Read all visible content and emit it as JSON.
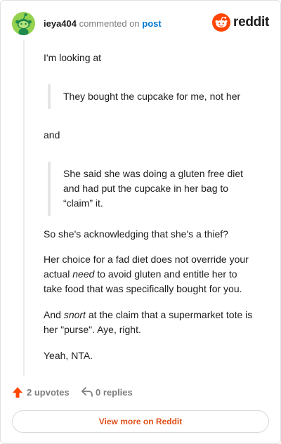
{
  "header": {
    "username": "ieya404",
    "action": "commented on",
    "post_link": "post",
    "logo_text": "reddit"
  },
  "comment": {
    "paragraph_1": "I'm looking at",
    "quote_1": "They bought the cupcake for me, not her",
    "paragraph_2": "and",
    "quote_2": "She said she was doing a gluten free diet and had put the cupcake in her bag to “claim” it.",
    "paragraph_3": "So she's acknowledging that she's a thief?",
    "paragraph_4": {
      "before": "Her choice for a fad diet does not override your actual ",
      "emphasis": "need",
      "after": " to avoid gluten and entitle her to take food that was specifically bought for you."
    },
    "paragraph_5": {
      "before": "And ",
      "emphasis": "snort",
      "after": " at the claim that a supermarket tote is her \"purse\". Aye, right."
    },
    "paragraph_6": "Yeah, NTA."
  },
  "footer": {
    "upvotes": "2 upvotes",
    "replies": "0 replies",
    "view_more": "View more on Reddit"
  },
  "colors": {
    "brand": "#ff4500",
    "link": "#0079d3",
    "avatar": "#94d14f"
  },
  "icons": {
    "avatar": "snoo-avatar-icon",
    "logo": "reddit-logo-icon",
    "upvote": "upvote-arrow-icon",
    "reply": "reply-arrow-icon"
  }
}
